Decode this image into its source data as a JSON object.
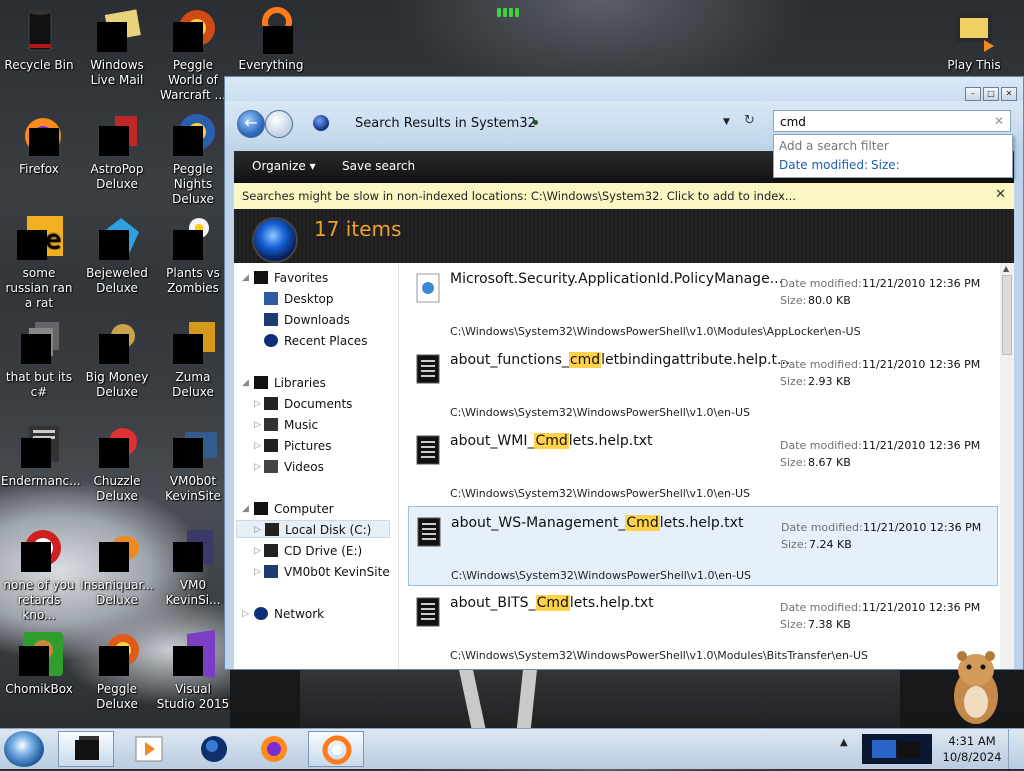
{
  "desktop": {
    "icons": [
      {
        "label": "Recycle Bin"
      },
      {
        "label": "Windows Live Mail"
      },
      {
        "label": "Peggle World of Warcraft ..."
      },
      {
        "label": "Everything"
      },
      {
        "label": "Play This"
      },
      {
        "label": "Firefox"
      },
      {
        "label": "AstroPop Deluxe"
      },
      {
        "label": "Peggle Nights Deluxe"
      },
      {
        "label": "some russian ran a rat"
      },
      {
        "label": "Bejeweled Deluxe"
      },
      {
        "label": "Plants vs Zombies"
      },
      {
        "label": "that but its c#"
      },
      {
        "label": "Big Money Deluxe"
      },
      {
        "label": "Zuma Deluxe"
      },
      {
        "label": "Endermanc..."
      },
      {
        "label": "Chuzzle Deluxe"
      },
      {
        "label": "VM0b0t KevinSite"
      },
      {
        "label": "none of you retards kno..."
      },
      {
        "label": "Insaniquar... Deluxe"
      },
      {
        "label": "VM0 KevinSi..."
      },
      {
        "label": "ChomikBox"
      },
      {
        "label": "Peggle Deluxe"
      },
      {
        "label": "Visual Studio 2015"
      }
    ]
  },
  "explorer": {
    "address": "Search Results in System32",
    "search": {
      "value": "cmd",
      "filter_header": "Add a search filter",
      "filter_date": "Date modified:",
      "filter_size": "Size:"
    },
    "toolbar": {
      "organize": "Organize",
      "save_search": "Save search"
    },
    "info_bar": "Searches might be slow in non-indexed locations: C:\\Windows\\System32. Click to add to index...",
    "item_count": "17 items",
    "nav": {
      "favorites": "Favorites",
      "desktop": "Desktop",
      "downloads": "Downloads",
      "recent": "Recent Places",
      "libraries": "Libraries",
      "documents": "Documents",
      "music": "Music",
      "pictures": "Pictures",
      "videos": "Videos",
      "computer": "Computer",
      "local_disk": "Local Disk (C:)",
      "cd_drive": "CD Drive (E:)",
      "vm_share": "VM0b0t KevinSite",
      "network": "Network"
    },
    "labels": {
      "date_modified": "Date modified:",
      "size": "Size:"
    },
    "results": [
      {
        "pre": "Microsoft.Security.ApplicationId.PolicyManage...",
        "match": "",
        "post": "",
        "date": "11/21/2010 12:36 PM",
        "size": "80.0 KB",
        "path": "C:\\Windows\\System32\\WindowsPowerShell\\v1.0\\Modules\\AppLocker\\en-US"
      },
      {
        "pre": "about_functions_",
        "match": "cmd",
        "post": "letbindingattribute.help.t...",
        "date": "11/21/2010 12:36 PM",
        "size": "2.93 KB",
        "path": "C:\\Windows\\System32\\WindowsPowerShell\\v1.0\\en-US"
      },
      {
        "pre": "about_WMI_",
        "match": "Cmd",
        "post": "lets.help.txt",
        "date": "11/21/2010 12:36 PM",
        "size": "8.67 KB",
        "path": "C:\\Windows\\System32\\WindowsPowerShell\\v1.0\\en-US"
      },
      {
        "pre": "about_WS-Management_",
        "match": "Cmd",
        "post": "lets.help.txt",
        "date": "11/21/2010 12:36 PM",
        "size": "7.24 KB",
        "path": "C:\\Windows\\System32\\WindowsPowerShell\\v1.0\\en-US"
      },
      {
        "pre": "about_BITS_",
        "match": "Cmd",
        "post": "lets.help.txt",
        "date": "11/21/2010 12:36 PM",
        "size": "7.38 KB",
        "path": "C:\\Windows\\System32\\WindowsPowerShell\\v1.0\\Modules\\BitsTransfer\\en-US"
      }
    ]
  },
  "taskbar": {
    "time": "4:31 AM",
    "date": "10/8/2024"
  },
  "colors": {
    "highlight": "#ffd24a",
    "item_count": "#f0a030",
    "selection": "#e6f0fa"
  }
}
